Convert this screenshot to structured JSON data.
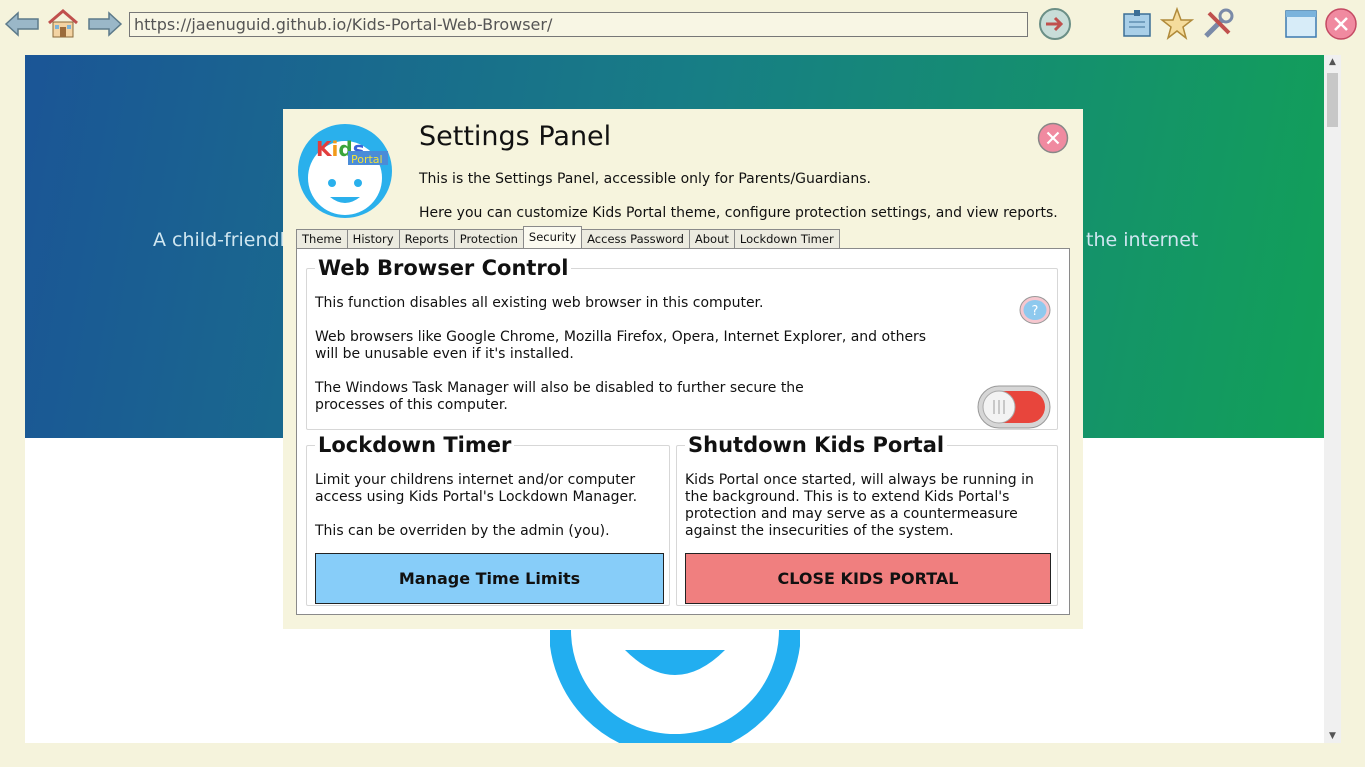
{
  "browser": {
    "url": "https://jaenuguid.github.io/Kids-Portal-Web-Browser/",
    "icons": [
      "back-arrow-icon",
      "home-icon",
      "forward-arrow-icon",
      "go-icon",
      "bookmarks-icon",
      "favorites-star-icon",
      "tools-icon",
      "window-icon",
      "close-icon"
    ]
  },
  "page": {
    "hero_text_left": "A child-friendl",
    "hero_text_right": "the internet"
  },
  "settings": {
    "title": "Settings Panel",
    "description1": "This is the Settings Panel, accessible only for Parents/Guardians.",
    "description2": "Here you can customize Kids Portal theme, configure protection settings, and view reports.",
    "logo_text_kids": "Kids",
    "logo_text_portal": "Portal",
    "tabs": [
      "Theme",
      "History",
      "Reports",
      "Protection",
      "Security",
      "Access Password",
      "About",
      "Lockdown Timer"
    ],
    "active_tab": "Security",
    "web_browser_control": {
      "title": "Web Browser Control",
      "p1": "This function disables all existing web browser in this computer.",
      "p2_line1": "Web browsers like Google Chrome, Mozilla Firefox, Opera, Internet Explorer, and others",
      "p2_line2": "will be unusable even if it's installed.",
      "p3_line1": "The Windows Task Manager will also be disabled to further secure the",
      "p3_line2": "processes of this computer.",
      "toggle_state": "off"
    },
    "lockdown_timer": {
      "title": "Lockdown Timer",
      "p1_line1": "Limit your childrens internet and/or computer",
      "p1_line2": "access using Kids Portal's Lockdown Manager.",
      "p2": "This can be overriden by the admin (you).",
      "button": "Manage Time Limits"
    },
    "shutdown": {
      "title": "Shutdown Kids Portal",
      "line1": "Kids Portal once started, will always be running in",
      "line2": "the background. This is to extend Kids Portal's",
      "line3": "protection and may serve as a countermeasure",
      "line4": "against the insecurities of the system.",
      "button": "CLOSE KIDS PORTAL"
    }
  },
  "colors": {
    "background": "#f5f3dc",
    "hero_start": "#1b5596",
    "hero_end": "#12a058",
    "manage_button": "#87cdf9",
    "close_button": "#f07f7f",
    "toggle_red": "#e8453c"
  }
}
